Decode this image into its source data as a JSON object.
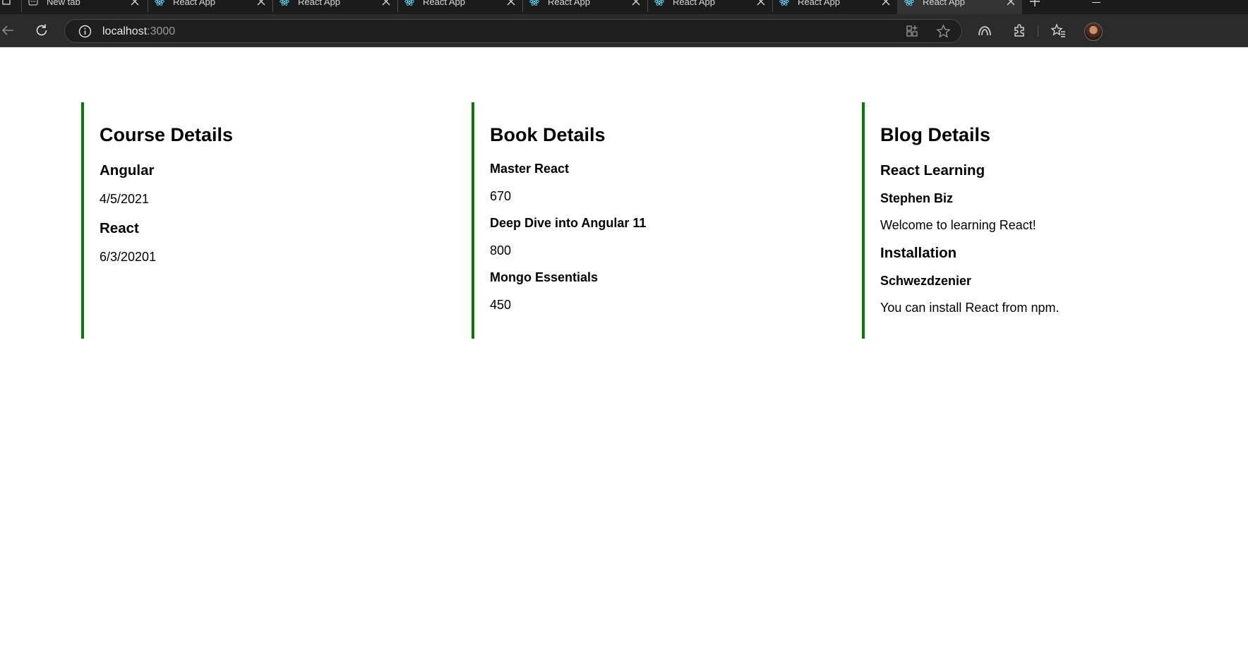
{
  "browser": {
    "tabs": [
      {
        "title": "New tab",
        "favicon": "new-tab-icon",
        "active": false
      },
      {
        "title": "React App",
        "favicon": "react-icon",
        "active": false
      },
      {
        "title": "React App",
        "favicon": "react-icon",
        "active": false
      },
      {
        "title": "React App",
        "favicon": "react-icon",
        "active": false
      },
      {
        "title": "React App",
        "favicon": "react-icon",
        "active": false
      },
      {
        "title": "React App",
        "favicon": "react-icon",
        "active": false
      },
      {
        "title": "React App",
        "favicon": "react-icon",
        "active": false
      },
      {
        "title": "React App",
        "favicon": "react-icon",
        "active": true
      }
    ],
    "address": {
      "host": "localhost",
      "port": ":3000"
    }
  },
  "colors": {
    "accent_border": "#0a7a0a",
    "react_blue": "#61dafb"
  },
  "course": {
    "heading": "Course Details",
    "items": [
      {
        "name": "Angular",
        "date": "4/5/2021"
      },
      {
        "name": "React",
        "date": "6/3/20201"
      }
    ]
  },
  "book": {
    "heading": "Book Details",
    "items": [
      {
        "name": "Master React",
        "price": "670"
      },
      {
        "name": "Deep Dive into Angular 11",
        "price": "800"
      },
      {
        "name": "Mongo Essentials",
        "price": "450"
      }
    ]
  },
  "blog": {
    "heading": "Blog Details",
    "items": [
      {
        "title": "React Learning",
        "author": "Stephen Biz",
        "content": "Welcome to learning React!"
      },
      {
        "title": "Installation",
        "author": "Schwezdzenier",
        "content": "You can install React from npm."
      }
    ]
  }
}
